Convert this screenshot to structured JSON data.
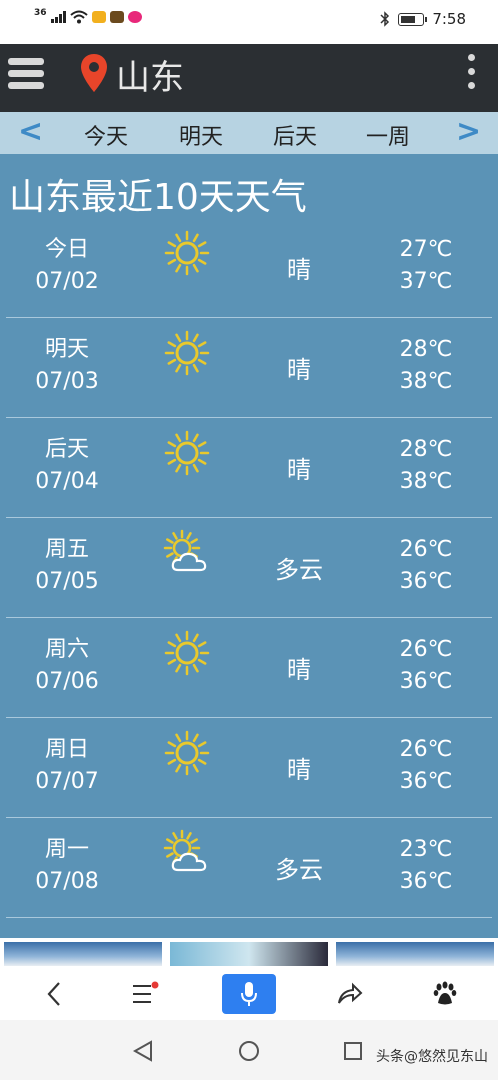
{
  "status_bar": {
    "signal_label": "36",
    "time": "7:58",
    "battery_level": 0.68
  },
  "header": {
    "city": "山东",
    "menu_icon": "hamburger-icon",
    "location_icon": "map-pin-icon",
    "more_icon": "kebab-icon",
    "pin_color": "#e8452a"
  },
  "tabs": {
    "prev_arrow": "<",
    "next_arrow": ">",
    "items": [
      "今天",
      "明天",
      "后天",
      "一周"
    ]
  },
  "forecast": {
    "title": "山东最近10天天气",
    "days": [
      {
        "label": "今日",
        "date": "07/02",
        "icon": "sunny-icon",
        "condition": "晴",
        "low": "27℃",
        "high": "37℃"
      },
      {
        "label": "明天",
        "date": "07/03",
        "icon": "sunny-icon",
        "condition": "晴",
        "low": "28℃",
        "high": "38℃"
      },
      {
        "label": "后天",
        "date": "07/04",
        "icon": "sunny-icon",
        "condition": "晴",
        "low": "28℃",
        "high": "38℃"
      },
      {
        "label": "周五",
        "date": "07/05",
        "icon": "partly-cloudy-icon",
        "condition": "多云",
        "low": "26℃",
        "high": "36℃"
      },
      {
        "label": "周六",
        "date": "07/06",
        "icon": "sunny-icon",
        "condition": "晴",
        "low": "26℃",
        "high": "36℃"
      },
      {
        "label": "周日",
        "date": "07/07",
        "icon": "sunny-icon",
        "condition": "晴",
        "low": "26℃",
        "high": "36℃"
      },
      {
        "label": "周一",
        "date": "07/08",
        "icon": "partly-cloudy-icon",
        "condition": "多云",
        "low": "23℃",
        "high": "36℃"
      }
    ]
  },
  "bottom_nav": {
    "items": [
      "back-icon",
      "menu-icon",
      "mic-icon",
      "share-icon",
      "baidu-paw-icon"
    ],
    "accent": "#2e7ff0",
    "badge_color": "#e53935"
  },
  "system_nav": {
    "items": [
      "back-triangle-icon",
      "home-circle-icon",
      "recents-square-icon"
    ]
  },
  "watermark": "头条@悠然见东山",
  "colors": {
    "panel": "#5b93b6",
    "topbar": "#2b2f33",
    "tabs_bg": "#b7d3e2",
    "arrow": "#3e8ac6",
    "sun": "#e9c92c"
  }
}
